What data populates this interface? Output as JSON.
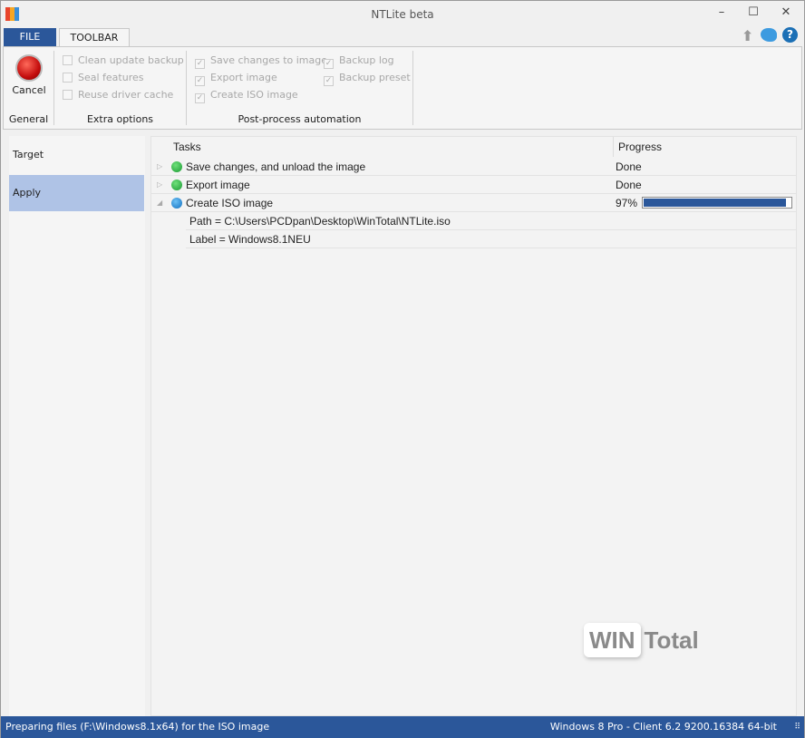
{
  "window": {
    "title": "NTLite beta",
    "minimize": "–",
    "maximize": "☐",
    "close": "✕"
  },
  "tabs": [
    {
      "label": "FILE"
    },
    {
      "label": "TOOLBAR"
    }
  ],
  "ribbon": {
    "general": {
      "label": "General",
      "cancel": "Cancel"
    },
    "extra": {
      "label": "Extra options",
      "items": [
        {
          "label": "Clean update backup",
          "checked": false
        },
        {
          "label": "Seal features",
          "checked": false
        },
        {
          "label": "Reuse driver cache",
          "checked": false
        }
      ]
    },
    "post": {
      "label": "Post-process automation",
      "items": [
        {
          "label": "Save changes to image",
          "checked": true
        },
        {
          "label": "Export image",
          "checked": true
        },
        {
          "label": "Create ISO image",
          "checked": true
        },
        {
          "label": "Backup log",
          "checked": true
        },
        {
          "label": "Backup preset",
          "checked": true
        }
      ]
    }
  },
  "nav": [
    {
      "label": "Target"
    },
    {
      "label": "Apply",
      "selected": true
    }
  ],
  "table": {
    "headers": [
      "Tasks",
      "Progress"
    ],
    "rows": [
      {
        "task": "Save changes, and unload the image",
        "progress": "Done",
        "status": "done"
      },
      {
        "task": "Export image",
        "progress": "Done",
        "status": "done"
      },
      {
        "task": "Create ISO image",
        "progress": "97%",
        "value": 97,
        "status": "running"
      }
    ],
    "details": [
      "Path = C:\\Users\\PCDpan\\Desktop\\WinTotal\\NTLite.iso",
      "Label = Windows8.1NEU"
    ]
  },
  "watermark": "WIN Total",
  "status": {
    "left": "Preparing files (F:\\Windows8.1x64) for the ISO image",
    "right": "Windows 8 Pro - Client 6.2 9200.16384 64-bit"
  },
  "colors": {
    "accent": "#2b579a",
    "done": "#2db84a",
    "running": "#1a82d0",
    "selected": "#afc3e6"
  }
}
